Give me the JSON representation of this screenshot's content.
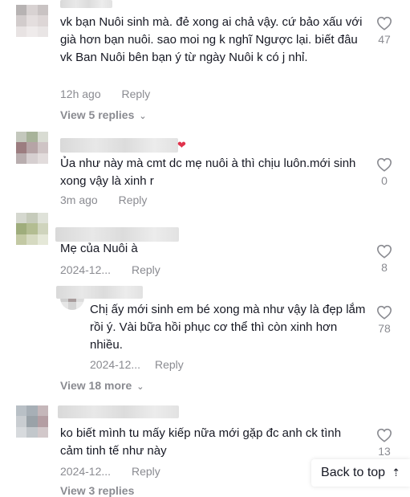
{
  "comments": [
    {
      "text": "vk bạn Nuôi sinh mà. đẻ xong ai chả vậy. cứ bảo xấu với già hơn bạn nuôi. sao moi ng k nghĩ Ngược lại. biết đâu vk Ban Nuôi bên bạn ý từ ngày Nuôi k có j nhỉ.",
      "time": "12h ago",
      "reply_label": "Reply",
      "likes": "47",
      "view_replies": "View 5 replies"
    },
    {
      "text": "Ủa như này mà cmt dc mẹ nuôi à thì chịu luôn.mới sinh xong vậy là xinh r",
      "time": "3m ago",
      "reply_label": "Reply",
      "likes": "0",
      "name_emoji": "❤"
    },
    {
      "text": "Mẹ của Nuôi à",
      "time": "2024-12...",
      "reply_label": "Reply",
      "likes": "8",
      "view_replies": "View 18 more"
    },
    {
      "text": "ko biết mình tu mấy kiếp nữa mới gặp đc anh ck tình cảm tinh tế như này",
      "time": "2024-12...",
      "reply_label": "Reply",
      "likes": "13",
      "view_replies": "View 3 replies"
    }
  ],
  "reply": {
    "text": "Chị ấy mới sinh em bé xong mà như vậy là đẹp lắm rồi ý. Vài bữa hồi phục cơ thể thì còn xinh hơn nhiều.",
    "time": "2024-12...",
    "reply_label": "Reply",
    "likes": "78"
  },
  "back_to_top": {
    "label": "Back to top",
    "arrow": "⇡"
  },
  "icons": {
    "like": "heart-outline-icon",
    "expand": "chevron-down-icon"
  },
  "colors": {
    "text": "#161823",
    "muted": "#8a8b91",
    "heart_emoji": "#e0334c"
  }
}
